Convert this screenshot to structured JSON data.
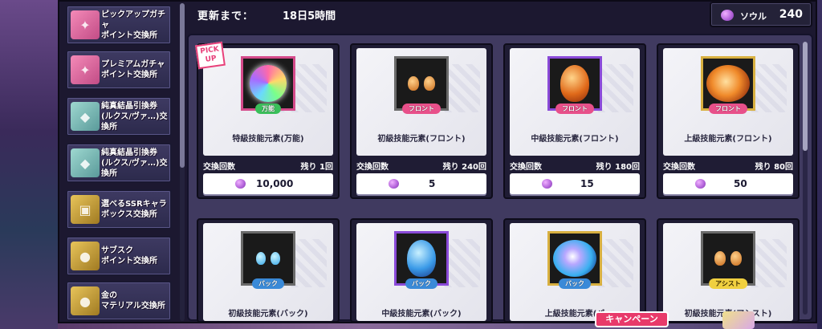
{
  "header": {
    "label": "更新まで：",
    "value": "18日5時間"
  },
  "currency": {
    "icon": "soul-icon",
    "label": "ソウル",
    "value": "240"
  },
  "sidebar": {
    "items": [
      {
        "label": "ピックアップガチャ\nポイント交換所",
        "icon": "gacha-ticket-icon",
        "color": "pink"
      },
      {
        "label": "プレミアムガチャ\nポイント交換所",
        "icon": "gacha-ticket-icon",
        "color": "pink"
      },
      {
        "label": "純真結晶引換券\n(ルクス/ヴァ…)交換所",
        "icon": "crystal-ticket-icon",
        "color": "teal"
      },
      {
        "label": "純真結晶引換券\n(ルクス/ヴァ…)交換所",
        "icon": "crystal-ticket-icon",
        "color": "teal"
      },
      {
        "label": "選べるSSRキャラ\nボックス交換所",
        "icon": "ssr-box-icon",
        "color": "gold"
      },
      {
        "label": "サブスク\nポイント交換所",
        "icon": "subscription-coin-icon",
        "color": "gold"
      },
      {
        "label": "金の\nマテリアル交換所",
        "icon": "gold-material-icon",
        "color": "gold"
      }
    ]
  },
  "exchange_label": "交換回数",
  "items": [
    {
      "name": "特級技能元素(万能)",
      "tag": "万能",
      "tag_color": "green",
      "remaining": "残り 1回",
      "cost": "10,000",
      "pickup": "PICK UP"
    },
    {
      "name": "初級技能元素(フロント)",
      "tag": "フロント",
      "tag_color": "pink",
      "remaining": "残り 240回",
      "cost": "5"
    },
    {
      "name": "中級技能元素(フロント)",
      "tag": "フロント",
      "tag_color": "pink",
      "remaining": "残り 180回",
      "cost": "15"
    },
    {
      "name": "上級技能元素(フロント)",
      "tag": "フロント",
      "tag_color": "pink",
      "remaining": "残り 80回",
      "cost": "50"
    },
    {
      "name": "初級技能元素(バック)",
      "tag": "バック",
      "tag_color": "blue"
    },
    {
      "name": "中級技能元素(バック)",
      "tag": "バック",
      "tag_color": "blue"
    },
    {
      "name": "上級技能元素(バ",
      "tag": "バック",
      "tag_color": "blue"
    },
    {
      "name": "初級技能元素(アシスト)",
      "tag": "アシスト",
      "tag_color": "yellow"
    }
  ],
  "campaign": "キャンペーン"
}
